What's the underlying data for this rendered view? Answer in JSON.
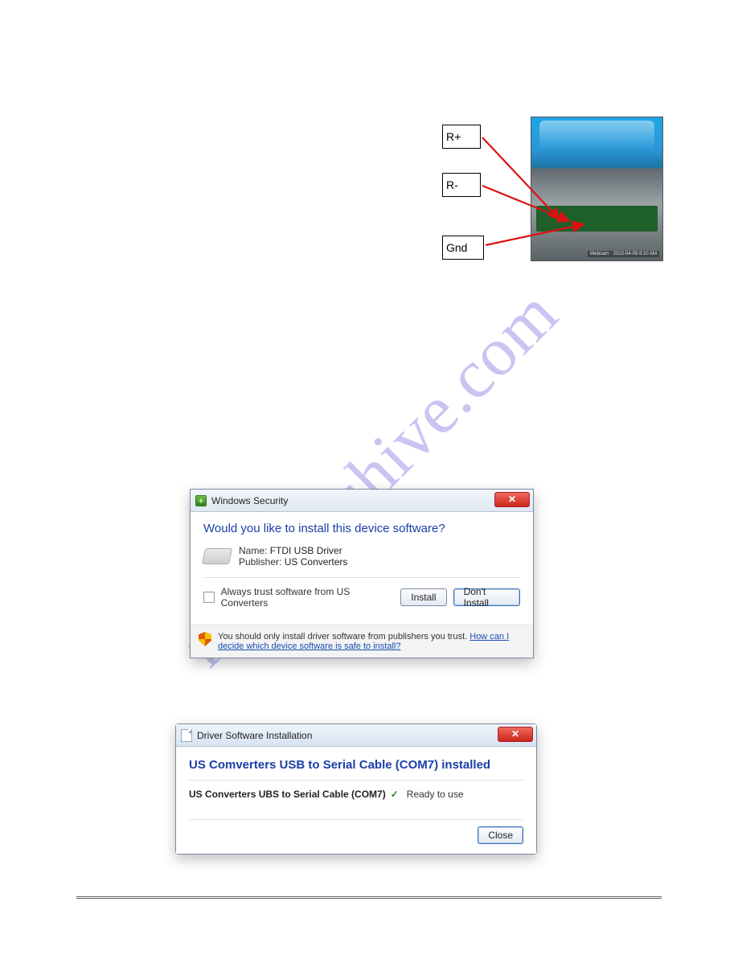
{
  "watermark": "manualshive.com",
  "diagram": {
    "labels": {
      "rplus": "R+",
      "rminus": "R-",
      "gnd": "Gnd"
    },
    "stamp": "Webcam · 2015-04-09 8:10 AM"
  },
  "dlg_security": {
    "title": "Windows Security",
    "headline": "Would you like to install this device software?",
    "name_label": "Name:",
    "name_value": "FTDI  USB Driver",
    "publisher_label": "Publisher:",
    "publisher_value": "US Converters",
    "always_trust": "Always trust software from US Converters",
    "install": "Install",
    "dont_install": "Don't Install",
    "info_text": "You should only install driver software from publishers you trust.  ",
    "info_link": "How can I decide which device software is safe to install?"
  },
  "dlg_install": {
    "title": "Driver Software Installation",
    "headline": "US Comverters USB to Serial Cable (COM7) installed",
    "device": "US Converters UBS to Serial Cable (COM7)",
    "status": "Ready to use",
    "close": "Close"
  }
}
